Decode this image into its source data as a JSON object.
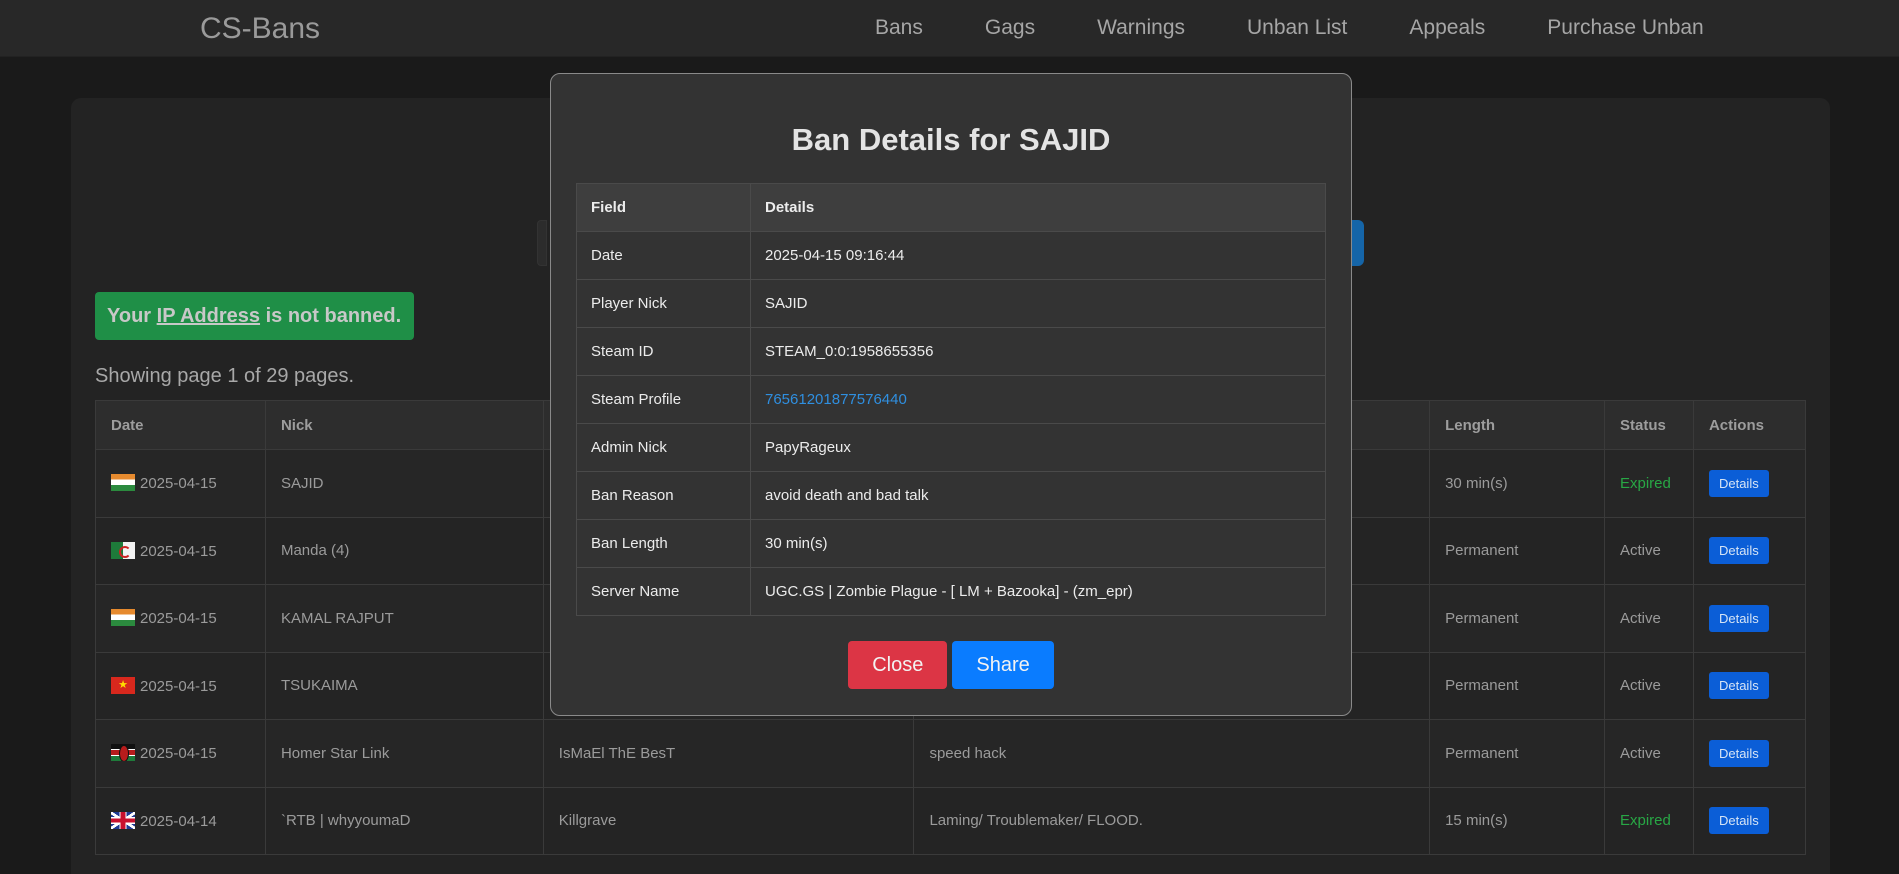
{
  "navbar": {
    "brand": "CS-Bans",
    "links": [
      "Bans",
      "Gags",
      "Warnings",
      "Unban List",
      "Appeals",
      "Purchase Unban"
    ]
  },
  "alert": {
    "prefix": "Your",
    "link": "IP Address",
    "suffix": "is not banned."
  },
  "page_info": "Showing page 1 of 29 pages.",
  "table": {
    "headers": {
      "date": "Date",
      "nick": "Nick",
      "admin": "",
      "reason": "",
      "length": "Length",
      "status": "Status",
      "actions": "Actions"
    },
    "rows": [
      {
        "flag": "india",
        "date": "2025-04-15",
        "nick": "SAJID",
        "admin": "",
        "reason": "",
        "length": "30 min(s)",
        "status": "Expired",
        "action": "Details"
      },
      {
        "flag": "algeria",
        "date": "2025-04-15",
        "nick": "Manda (4)",
        "admin": "",
        "reason": "",
        "length": "Permanent",
        "status": "Active",
        "action": "Details"
      },
      {
        "flag": "india",
        "date": "2025-04-15",
        "nick": "KAMAL RAJPUT",
        "admin": "",
        "reason": "",
        "length": "Permanent",
        "status": "Active",
        "action": "Details"
      },
      {
        "flag": "vietnam",
        "date": "2025-04-15",
        "nick": "TSUKAIMA",
        "admin": "",
        "reason": "",
        "length": "Permanent",
        "status": "Active",
        "action": "Details"
      },
      {
        "flag": "kenya",
        "date": "2025-04-15",
        "nick": "Homer Star Link",
        "admin": "IsMaEl ThE BesT",
        "reason": "speed hack",
        "length": "Permanent",
        "status": "Active",
        "action": "Details"
      },
      {
        "flag": "united-kingdom",
        "date": "2025-04-14",
        "nick": "`RTB | whyyoumaD",
        "admin": "Killgrave",
        "reason": "Laming/ Troublemaker/ FLOOD.",
        "length": "15 min(s)",
        "status": "Expired",
        "action": "Details"
      }
    ]
  },
  "modal": {
    "title": "Ban Details for SAJID",
    "headers": {
      "field": "Field",
      "details": "Details"
    },
    "rows": [
      {
        "field": "Date",
        "value": "2025-04-15 09:16:44"
      },
      {
        "field": "Player Nick",
        "value": "SAJID"
      },
      {
        "field": "Steam ID",
        "value": "STEAM_0:0:1958655356"
      },
      {
        "field": "Steam Profile",
        "value": "76561201877576440"
      },
      {
        "field": "Admin Nick",
        "value": "PapyRageux"
      },
      {
        "field": "Ban Reason",
        "value": "avoid death and bad talk"
      },
      {
        "field": "Ban Length",
        "value": "30 min(s)"
      },
      {
        "field": "Server Name",
        "value": "UGC.GS | Zombie Plague - [ LM + Bazooka] - (zm_epr)"
      }
    ],
    "close_label": "Close",
    "share_label": "Share"
  },
  "colors": {
    "expired": "#28a745",
    "details_button": "#0b5ed7",
    "close_button": "#dc3545",
    "share_button": "#0a7cff",
    "link": "#2f8fe0"
  }
}
